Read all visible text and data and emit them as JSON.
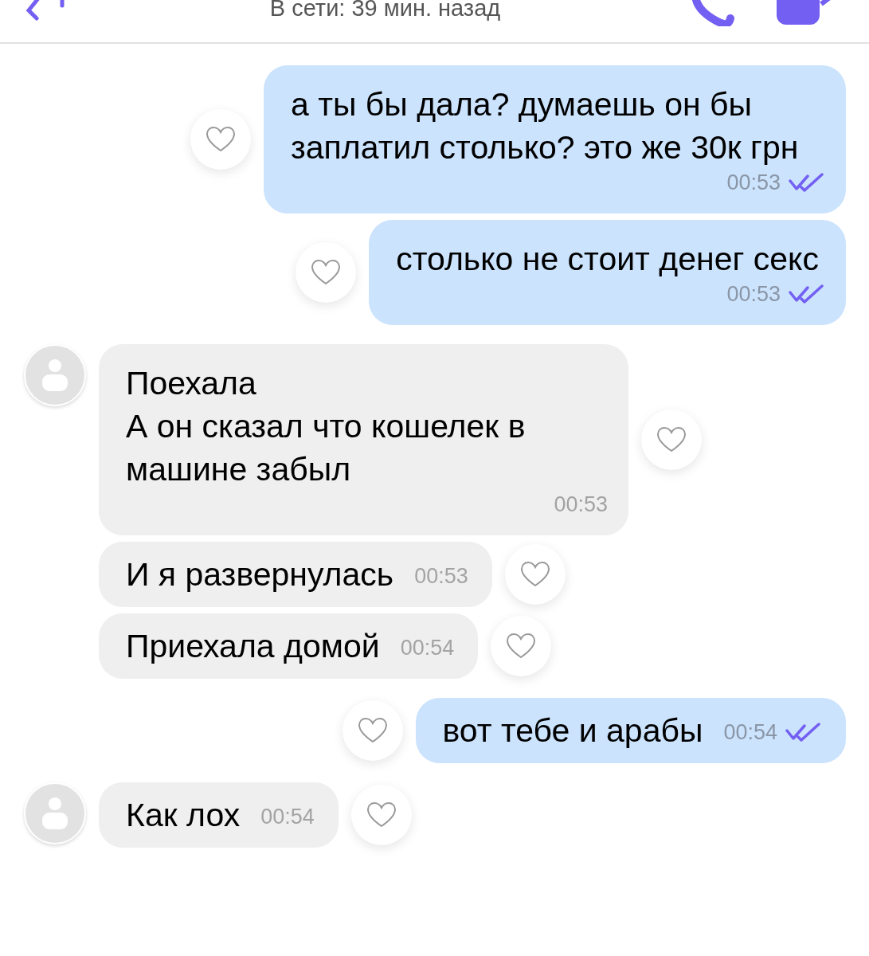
{
  "header": {
    "status": "В сети: 39 мин. назад"
  },
  "messages": [
    {
      "kind": "out",
      "text": "а ты бы дала? думаешь он бы заплатил столько? это же 30к грн",
      "time": "00:53",
      "read": true
    },
    {
      "kind": "out",
      "text": "столько не стоит денег секс",
      "time": "00:53",
      "read": true
    },
    {
      "kind": "in",
      "text": "Поехала\nА он сказал что кошелек в машине забыл",
      "time": "00:53"
    },
    {
      "kind": "in",
      "text": "И я развернулась",
      "time": "00:53"
    },
    {
      "kind": "in",
      "text": "Приехала домой",
      "time": "00:54"
    },
    {
      "kind": "out",
      "text": "вот тебе и арабы",
      "time": "00:54",
      "read": true
    },
    {
      "kind": "in",
      "text": "Как лох",
      "time": "00:54"
    }
  ]
}
